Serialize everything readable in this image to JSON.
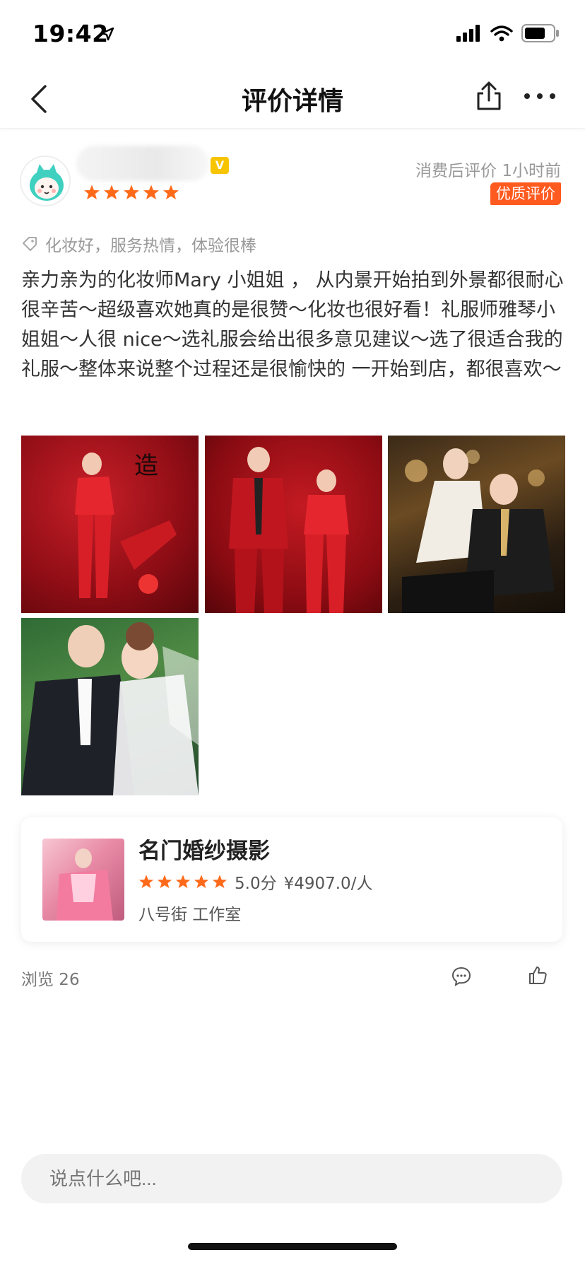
{
  "status_bar": {
    "time": "19:42"
  },
  "nav": {
    "title": "评价详情"
  },
  "review": {
    "meta": "消费后评价  1小时前",
    "badge": "优质评价",
    "tag": "化妆好，服务热情，体验很棒",
    "text": "亲力亲为的化妆师Mary 小姐姐 ， 从内景开始拍到外景都很耐心很辛苦～超级喜欢她真的是很赞～化妆也很好看！礼服师雅琴小姐姐～人很 nice～选礼服会给出很多意见建议～选了很适合我的礼服～整体来说整个过程还是很愉快的 一开始到店，都很喜欢～",
    "stars": 5,
    "photos": [
      "photo-red-couple-1",
      "photo-red-couple-2",
      "photo-night-couple",
      "photo-wedding-garden"
    ]
  },
  "shop": {
    "name": "名门婚纱摄影",
    "rating": "5.0分",
    "price": "¥4907.0/人",
    "address": "八号街 工作室",
    "stars": 5
  },
  "stats": {
    "views": "浏览 26"
  },
  "comment": {
    "placeholder": "说点什么吧..."
  },
  "colors": {
    "accent": "#ff5a1f",
    "star": "#ff6a1a",
    "badge_vip": "#f7c400"
  }
}
